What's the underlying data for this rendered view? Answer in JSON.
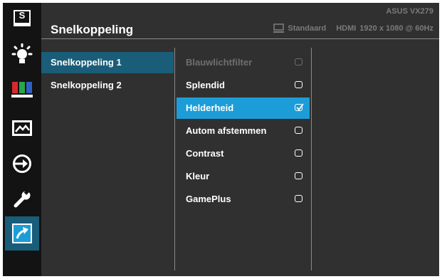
{
  "header": {
    "title": "Snelkoppeling",
    "model": "ASUS VX279",
    "mode": "Standaard",
    "input": "HDMI",
    "resolution": "1920 x 1080 @ 60Hz"
  },
  "sidebar": {
    "items": [
      {
        "name": "splendid-icon",
        "glyph": "S"
      },
      {
        "name": "blue-light-icon"
      },
      {
        "name": "color-icon"
      },
      {
        "name": "image-icon"
      },
      {
        "name": "input-select-icon"
      },
      {
        "name": "system-setup-icon"
      },
      {
        "name": "shortcut-icon",
        "active": true
      }
    ]
  },
  "shortcuts": {
    "items": [
      {
        "label": "Snelkoppeling 1",
        "selected": true
      },
      {
        "label": "Snelkoppeling 2",
        "selected": false
      }
    ]
  },
  "options": {
    "items": [
      {
        "label": "Blauwlichtfilter",
        "checked": false,
        "disabled": true
      },
      {
        "label": "Splendid",
        "checked": false
      },
      {
        "label": "Helderheid",
        "checked": true,
        "highlighted": true
      },
      {
        "label": "Autom afstemmen",
        "checked": false
      },
      {
        "label": "Contrast",
        "checked": false
      },
      {
        "label": "Kleur",
        "checked": false
      },
      {
        "label": "GamePlus",
        "checked": false
      }
    ]
  },
  "colors": {
    "panel": "#303030",
    "sidebar": "#131313",
    "selected": "#1a5d79",
    "highlight": "#1d9dd8",
    "icon_accent": "#1d9dd8"
  }
}
